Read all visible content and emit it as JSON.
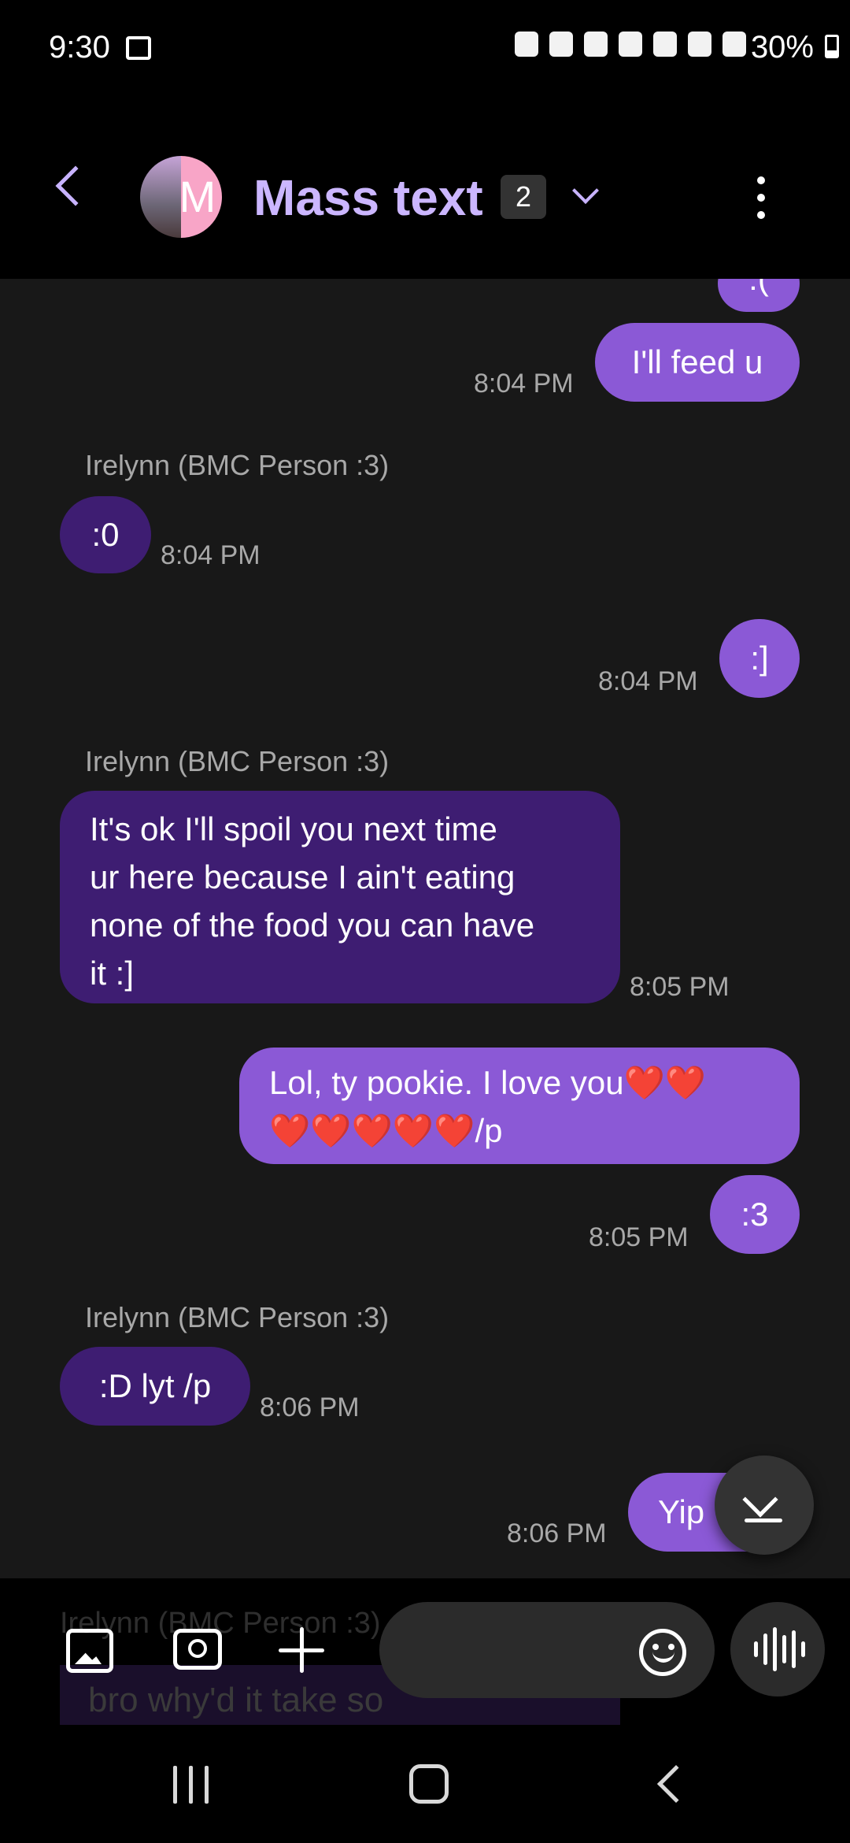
{
  "status_bar": {
    "time": "9:30",
    "battery": "30%",
    "battery_level_percent": 30
  },
  "header": {
    "title": "Mass text",
    "participant_count": "2",
    "avatar_initial": "M"
  },
  "messages": [
    {
      "direction": "out",
      "text": ":(",
      "time": ""
    },
    {
      "direction": "out",
      "text": "I'll feed u",
      "time": "8:04 PM"
    },
    {
      "direction": "in",
      "sender": "Irelynn (BMC Person :3)",
      "text": ":0",
      "time": "8:04 PM"
    },
    {
      "direction": "out",
      "text": ":]",
      "time": "8:04 PM"
    },
    {
      "direction": "in",
      "sender": "Irelynn (BMC Person :3)",
      "text_lines": [
        "It's ok I'll spoil you next time",
        "ur here because I ain't eating",
        "none of the food you can have",
        "it :]"
      ],
      "time": "8:05 PM"
    },
    {
      "direction": "out",
      "text_lines": [
        "Lol, ty pookie. I love you❤️❤️",
        "❤️❤️❤️❤️❤️/p"
      ],
      "time": ""
    },
    {
      "direction": "out",
      "text": ":3",
      "time": "8:05 PM"
    },
    {
      "direction": "in",
      "sender": "Irelynn (BMC Person :3)",
      "text": ":D lyt /p",
      "time": "8:06 PM"
    },
    {
      "direction": "out",
      "text": "Yip",
      "time": "8:06 PM"
    }
  ],
  "composer": {
    "ghost_sender": "Irelynn (BMC Person :3)",
    "ghost_text": "bro why'd it take so"
  },
  "icons": {
    "back": "back-arrow-icon",
    "dropdown": "chevron-down-icon",
    "menu": "more-options-icon",
    "scroll_down": "scroll-to-bottom-icon",
    "gallery": "gallery-icon",
    "camera": "camera-icon",
    "add": "plus-icon",
    "emoji": "emoji-icon",
    "voice": "voice-waveform-icon"
  },
  "colors": {
    "outgoing_bubble": "#8b59d6",
    "incoming_bubble": "#3e1d72",
    "title": "#cbb6ff",
    "chat_background": "#181818"
  }
}
